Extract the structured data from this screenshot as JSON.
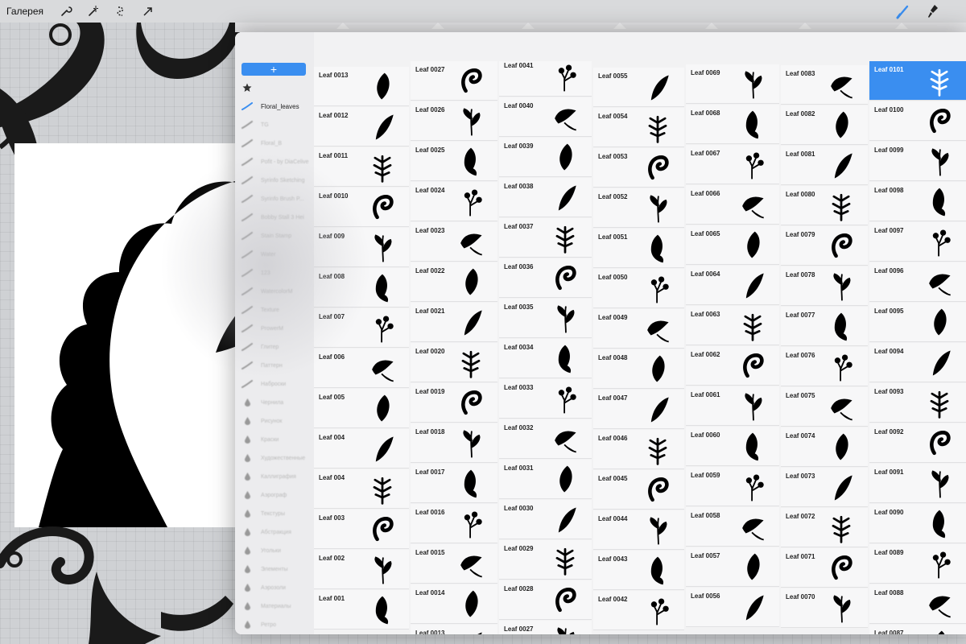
{
  "topbar": {
    "gallery_label": "Галерея",
    "left_tools": [
      "wrench-icon",
      "magic-wand-icon",
      "selection-icon",
      "transform-arrow-icon"
    ],
    "right_tools": [
      "brush-icon",
      "smudge-icon"
    ],
    "accent": "#3a8ef0"
  },
  "brush_sets": {
    "add_label": "+",
    "items": [
      {
        "icon": "star-icon",
        "label": "",
        "state": "normal"
      },
      {
        "icon": "brush-stroke-icon",
        "label": "Floral_leaves",
        "state": "active"
      },
      {
        "icon": "brush-stroke-icon",
        "label": "TG",
        "state": "faded"
      },
      {
        "icon": "brush-stroke-icon",
        "label": "Floral_B",
        "state": "faded"
      },
      {
        "icon": "brush-stroke-icon",
        "label": "Pofit - by DiaCelive",
        "state": "faded"
      },
      {
        "icon": "brush-stroke-icon",
        "label": "Syrinfo Sketching",
        "state": "faded"
      },
      {
        "icon": "brush-stroke-icon",
        "label": "Syrinfo Brush P...",
        "state": "faded"
      },
      {
        "icon": "brush-stroke-icon",
        "label": "Bobby Stall 3 Hei",
        "state": "faded"
      },
      {
        "icon": "brush-stroke-icon",
        "label": "Stain Stamp",
        "state": "faded"
      },
      {
        "icon": "brush-stroke-icon",
        "label": "Water",
        "state": "faded"
      },
      {
        "icon": "brush-stroke-icon",
        "label": "123",
        "state": "faded"
      },
      {
        "icon": "brush-stroke-icon",
        "label": "WatercolorM",
        "state": "faded"
      },
      {
        "icon": "brush-stroke-icon",
        "label": "Texture",
        "state": "faded"
      },
      {
        "icon": "brush-stroke-icon",
        "label": "ProwerM",
        "state": "faded"
      },
      {
        "icon": "brush-stroke-icon",
        "label": "Глитер",
        "state": "faded"
      },
      {
        "icon": "brush-stroke-icon",
        "label": "Паттерн",
        "state": "faded"
      },
      {
        "icon": "brush-stroke-icon",
        "label": "Наброски",
        "state": "faded"
      },
      {
        "icon": "ink-drop-icon",
        "label": "Чернила",
        "state": "faded"
      },
      {
        "icon": "pencil-icon",
        "label": "Рисунок",
        "state": "faded"
      },
      {
        "icon": "paint-icon",
        "label": "Краски",
        "state": "faded"
      },
      {
        "icon": "palette-icon",
        "label": "Художественные",
        "state": "faded"
      },
      {
        "icon": "calligraphy-icon",
        "label": "Каллиграфия",
        "state": "faded"
      },
      {
        "icon": "airbrush-icon",
        "label": "Аэрограф",
        "state": "faded"
      },
      {
        "icon": "texture-icon",
        "label": "Текстуры",
        "state": "faded"
      },
      {
        "icon": "abstract-icon",
        "label": "Абстракция",
        "state": "faded"
      },
      {
        "icon": "charcoal-icon",
        "label": "Угольки",
        "state": "faded"
      },
      {
        "icon": "elements-icon",
        "label": "Элементы",
        "state": "faded"
      },
      {
        "icon": "spray-icon",
        "label": "Аэрозоли",
        "state": "faded"
      },
      {
        "icon": "materials-icon",
        "label": "Материалы",
        "state": "faded"
      },
      {
        "icon": "retro-icon",
        "label": "Ретро",
        "state": "faded"
      }
    ]
  },
  "brush_columns": [
    {
      "items": [
        "Leaf 0013",
        "Leaf 0012",
        "Leaf 0011",
        "Leaf 0010",
        "Leaf 009",
        "Leaf 008",
        "Leaf 007",
        "Leaf 006",
        "Leaf 005",
        "Leaf 004",
        "Leaf 004",
        "Leaf 003",
        "Leaf 002",
        "Leaf 001"
      ]
    },
    {
      "items": [
        "Leaf 0027",
        "Leaf 0026",
        "Leaf 0025",
        "Leaf 0024",
        "Leaf 0023",
        "Leaf 0022",
        "Leaf 0021",
        "Leaf 0020",
        "Leaf 0019",
        "Leaf 0018",
        "Leaf 0017",
        "Leaf 0016",
        "Leaf 0015",
        "Leaf 0014",
        "Leaf 0013"
      ]
    },
    {
      "items": [
        "Leaf 0041",
        "Leaf 0040",
        "Leaf 0039",
        "Leaf 0038",
        "Leaf 0037",
        "Leaf 0036",
        "Leaf 0035",
        "Leaf 0034",
        "Leaf 0033",
        "Leaf 0032",
        "Leaf 0031",
        "Leaf 0030",
        "Leaf 0029",
        "Leaf 0028",
        "Leaf 0027"
      ]
    },
    {
      "items": [
        "Leaf 0055",
        "Leaf 0054",
        "Leaf 0053",
        "Leaf 0052",
        "Leaf 0051",
        "Leaf 0050",
        "Leaf 0049",
        "Leaf 0048",
        "Leaf 0047",
        "Leaf 0046",
        "Leaf 0045",
        "Leaf 0044",
        "Leaf 0043",
        "Leaf 0042"
      ]
    },
    {
      "items": [
        "Leaf 0069",
        "Leaf 0068",
        "Leaf 0067",
        "Leaf 0066",
        "Leaf 0065",
        "Leaf 0064",
        "Leaf 0063",
        "Leaf 0062",
        "Leaf 0061",
        "Leaf 0060",
        "Leaf 0059",
        "Leaf 0058",
        "Leaf 0057",
        "Leaf 0056"
      ]
    },
    {
      "items": [
        "Leaf 0083",
        "Leaf 0082",
        "Leaf 0081",
        "Leaf 0080",
        "Leaf 0079",
        "Leaf 0078",
        "Leaf 0077",
        "Leaf 0076",
        "Leaf 0075",
        "Leaf 0074",
        "Leaf 0073",
        "Leaf 0072",
        "Leaf 0071",
        "Leaf 0070"
      ]
    },
    {
      "items": [
        "Leaf 0101",
        "Leaf 0100",
        "Leaf 0099",
        "Leaf 0098",
        "Leaf 0097",
        "Leaf 0096",
        "Leaf 0095",
        "Leaf 0094",
        "Leaf 0093",
        "Leaf 0092",
        "Leaf 0091",
        "Leaf 0090",
        "Leaf 0089",
        "Leaf 0088",
        "Leaf 0087"
      ],
      "selected": "Leaf 0101"
    }
  ]
}
